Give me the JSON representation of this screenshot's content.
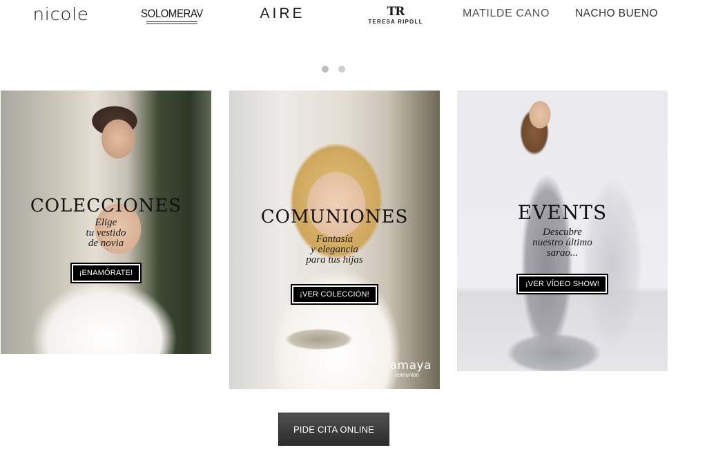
{
  "brands": [
    {
      "id": "nicole",
      "label": "nicole"
    },
    {
      "id": "solomerav",
      "label": "SOLOMERAV"
    },
    {
      "id": "aire",
      "label": "AIRE"
    },
    {
      "id": "teresa-ripoll",
      "monogram": "TR",
      "label": "TERESA RIPOLL"
    },
    {
      "id": "matilde-cano",
      "label": "MATILDE CANO"
    },
    {
      "id": "nacho-bueno",
      "label": "NACHO BUENO"
    }
  ],
  "carousel": {
    "dot_count": 2,
    "active_index": 0
  },
  "cards": [
    {
      "title": "COLECCIONES",
      "subtitle": "Elige\ntu vestido\nde novia",
      "button": "¡ENAMÓRATE!"
    },
    {
      "title": "COMUNIONES",
      "subtitle": "Fantasía\ny elegancia\npara tus hijas",
      "button": "¡VER COLECCIÓN!",
      "brand_mark": "amaya",
      "brand_mark_sub": "comunión"
    },
    {
      "title": "EVENTS",
      "subtitle": "Descubre\nnuestro último\nsarao...",
      "button": "¡VER VÍDEO SHOW!"
    }
  ],
  "cta": {
    "label": "PIDE CITA ONLINE"
  },
  "colors": {
    "button_bg": "#000000",
    "cta_bg": "#3a3a3a",
    "dot": "#cfcfcf"
  }
}
